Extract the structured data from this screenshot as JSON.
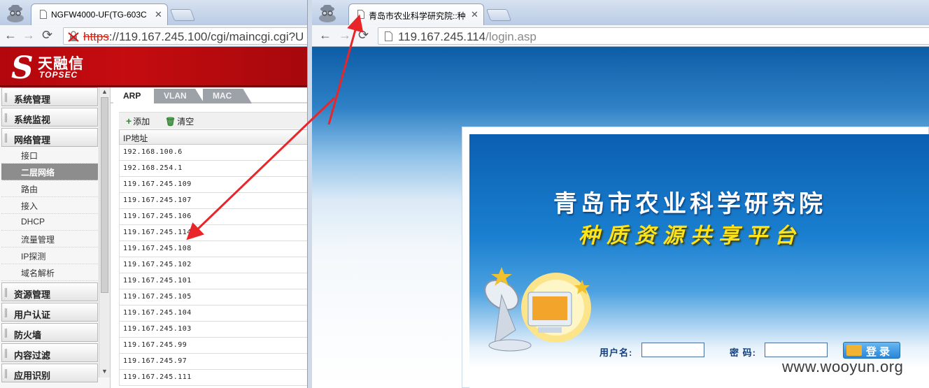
{
  "left_browser": {
    "tab_title": "NGFW4000-UF(TG-603C",
    "url": "https://119.167.245.100/cgi/maincgi.cgi?U",
    "url_scheme": "https",
    "url_rest": "://119.167.245.100/cgi/maincgi.cgi?U"
  },
  "topsec": {
    "logo_cn": "天融信",
    "logo_en": "TOPSEC",
    "menu": [
      {
        "label": "系统管理",
        "type": "section"
      },
      {
        "label": "系统监视",
        "type": "section"
      },
      {
        "label": "网络管理",
        "type": "section"
      },
      {
        "label": "接口",
        "type": "item"
      },
      {
        "label": "二层网络",
        "type": "item",
        "active": true
      },
      {
        "label": "路由",
        "type": "item"
      },
      {
        "label": "接入",
        "type": "item"
      },
      {
        "label": "DHCP",
        "type": "item"
      },
      {
        "label": "流量管理",
        "type": "item"
      },
      {
        "label": "IP探测",
        "type": "item"
      },
      {
        "label": "域名解析",
        "type": "item"
      },
      {
        "label": "资源管理",
        "type": "section"
      },
      {
        "label": "用户认证",
        "type": "section"
      },
      {
        "label": "防火墙",
        "type": "section"
      },
      {
        "label": "内容过滤",
        "type": "section"
      },
      {
        "label": "应用识别",
        "type": "section"
      }
    ],
    "tabs": [
      "ARP",
      "VLAN",
      "MAC"
    ],
    "active_tab": "ARP",
    "add_label": "添加",
    "clear_label": "清空",
    "column_header": "IP地址",
    "ip_rows": [
      "192.168.100.6",
      "192.168.254.1",
      "119.167.245.109",
      "119.167.245.107",
      "119.167.245.106",
      "119.167.245.114",
      "119.167.245.108",
      "119.167.245.102",
      "119.167.245.101",
      "119.167.245.105",
      "119.167.245.104",
      "119.167.245.103",
      "119.167.245.99",
      "119.167.245.97",
      "119.167.245.111"
    ]
  },
  "right_browser": {
    "tab_title": "青岛市农业科学研究院::种",
    "url": "119.167.245.114/login.asp",
    "url_host": "119.167.245.114",
    "url_path": "/login.asp"
  },
  "login_page": {
    "title": "青岛市农业科学研究院",
    "subtitle": "种质资源共享平台",
    "username_label": "用户名:",
    "password_label": "密 码:",
    "login_button": "登录"
  },
  "watermark": "www.wooyun.org",
  "colors": {
    "topsec_red": "#c50c10",
    "login_blue": "#1a7fd0",
    "subtitle_yellow": "#ffe31a",
    "arrow_red": "#e8262a"
  }
}
